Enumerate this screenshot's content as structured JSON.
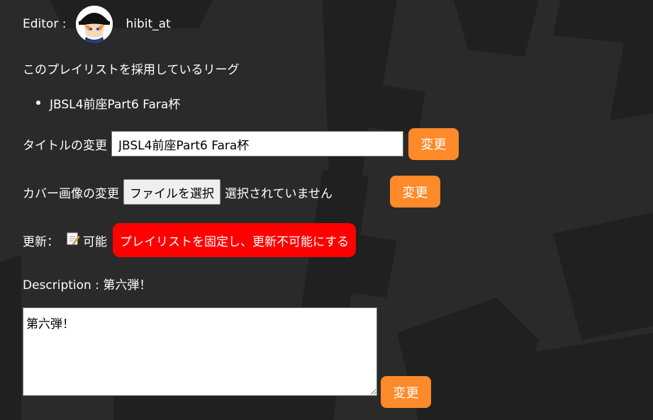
{
  "editor": {
    "label": "Editor :",
    "username": "hibit_at"
  },
  "leagues": {
    "heading": "このプレイリストを採用しているリーグ",
    "items": [
      "JBSL4前座Part6 Fara杯"
    ]
  },
  "title_change": {
    "label": "タイトルの変更",
    "value": "JBSL4前座Part6 Fara杯",
    "button": "変更"
  },
  "cover_change": {
    "label": "カバー画像の変更",
    "file_button": "ファイルを選択",
    "file_status": "選択されていません",
    "button": "変更"
  },
  "update": {
    "label": "更新：",
    "status_icon": "memo-icon",
    "status": "可能",
    "lock_button": "プレイリストを固定し、更新不可能にする"
  },
  "description": {
    "label": "Description : 第六弾！",
    "value": "第六弾！",
    "button": "変更"
  },
  "colors": {
    "background": "#2a2a2a",
    "accent": "#ff8a2a",
    "danger": "#ff0000"
  }
}
